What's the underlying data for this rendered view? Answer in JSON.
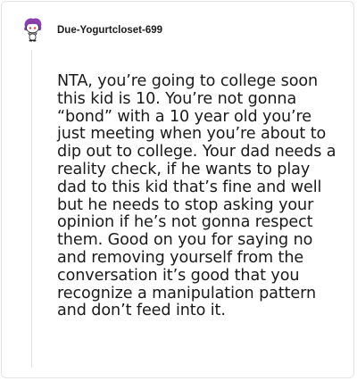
{
  "comment": {
    "author": "Due-Yogurtcloset-699",
    "avatar_icon": "snoo-avatar-icon",
    "body": "NTA, you’re going to college soon this kid is 10. You’re not gonna “bond” with a 10 year old you’re just meeting when you’re about to dip out to college. Your dad needs a reality check, if he wants to play dad to this kid that’s fine and well but he needs to stop asking your opinion if he’s not gonna respect them. Good on you for saying no and removing yourself from the conversation it’s good that you recognize a manipulation pattern and don’t feed into it."
  },
  "colors": {
    "avatar_accent": "#8c3fb0",
    "text": "#1a1a1b",
    "thread_line": "#e2e2e2"
  }
}
